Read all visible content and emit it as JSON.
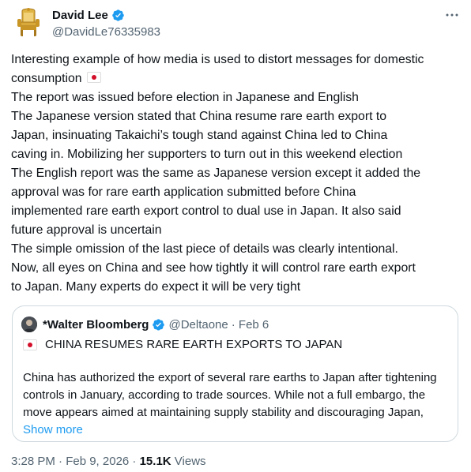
{
  "author": {
    "display_name": "David Lee",
    "handle": "@DavidLe76335983"
  },
  "icons": {
    "verified": "verified-badge-icon",
    "more": "more-options-icon",
    "flag": "japan-flag-emoji"
  },
  "post": {
    "lines": [
      "Interesting example of how media is used to distort messages for domestic",
      "consumption",
      "The report was issued before election in Japanese and English",
      "The Japanese version stated that China resume rare earth export to",
      "Japan, insinuating Takaichi’s tough stand against China led to China",
      "caving in. Mobilizing her supporters to turn out in this weekend election",
      "The English report was the same as Japanese version except it added the",
      "approval was for rare earth application submitted before China",
      "implemented rare earth export control to dual use in Japan. It also said",
      "future approval is uncertain",
      "The simple omission of the last piece of details was clearly intentional.",
      "Now, all eyes on China and see how tightly it will control rare earth export",
      "to Japan. Many experts do expect it will be very tight"
    ]
  },
  "quote": {
    "display_name": "*Walter Bloomberg",
    "handle": "@Deltaone",
    "date": "· Feb 6",
    "headline": "CHINA RESUMES RARE EARTH EXPORTS TO JAPAN",
    "body_lines": [
      "China has authorized the export of several rare earths to Japan after tightening",
      "controls in January, according to trade sources. While not a full embargo, the",
      "move appears aimed at maintaining supply stability and discouraging Japan,"
    ],
    "show_more": "Show more"
  },
  "footer": {
    "timestamp": "3:28 PM · Feb 9, 2026 ·",
    "views_count": "15.1K",
    "views_label": "Views"
  },
  "colors": {
    "verified": "#1d9bf0",
    "link": "#1d9bf0",
    "muted": "#536471",
    "border": "#cfd9de"
  }
}
